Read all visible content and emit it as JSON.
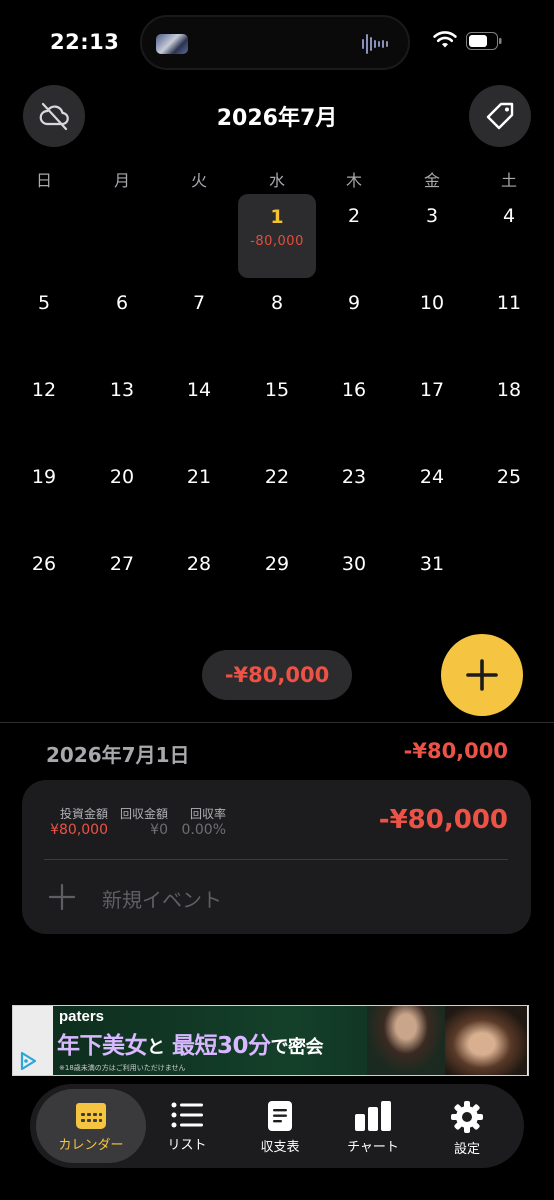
{
  "status": {
    "time": "22:13"
  },
  "header": {
    "title": "2026年7月"
  },
  "weekdays": [
    "日",
    "月",
    "火",
    "水",
    "木",
    "金",
    "土"
  ],
  "calendar": {
    "today_day": "1",
    "today_amount": "-80,000",
    "days": [
      "2",
      "3",
      "4",
      "5",
      "6",
      "7",
      "8",
      "9",
      "10",
      "11",
      "12",
      "13",
      "14",
      "15",
      "16",
      "17",
      "18",
      "19",
      "20",
      "21",
      "22",
      "23",
      "24",
      "25",
      "26",
      "27",
      "28",
      "29",
      "30",
      "31"
    ]
  },
  "summary": {
    "total": "-¥80,000"
  },
  "detail": {
    "date": "2026年7月1日",
    "total": "-¥80,000",
    "labels": {
      "invest": "投資金額",
      "recover": "回収金額",
      "rate": "回収率"
    },
    "values": {
      "invest": "¥80,000",
      "recover": "¥0",
      "rate": "0.00%"
    },
    "amount": "-¥80,000",
    "new_event": "新規イベント"
  },
  "ad": {
    "brand": "paters",
    "headline_a": "年下美女",
    "headline_b": "と",
    "headline_c": "最短30分",
    "headline_d": "で密会",
    "fine": "※18歳未満の方はご利用いただけません"
  },
  "tabs": [
    {
      "label": "カレンダー",
      "icon": "calendar-icon",
      "active": true
    },
    {
      "label": "リスト",
      "icon": "list-icon"
    },
    {
      "label": "収支表",
      "icon": "document-icon"
    },
    {
      "label": "チャート",
      "icon": "bar-chart-icon"
    },
    {
      "label": "設定",
      "icon": "gear-icon"
    }
  ],
  "colors": {
    "accent": "#f5c542",
    "negative": "#ec5246",
    "background": "#000000",
    "surface": "#1c1c1e"
  }
}
